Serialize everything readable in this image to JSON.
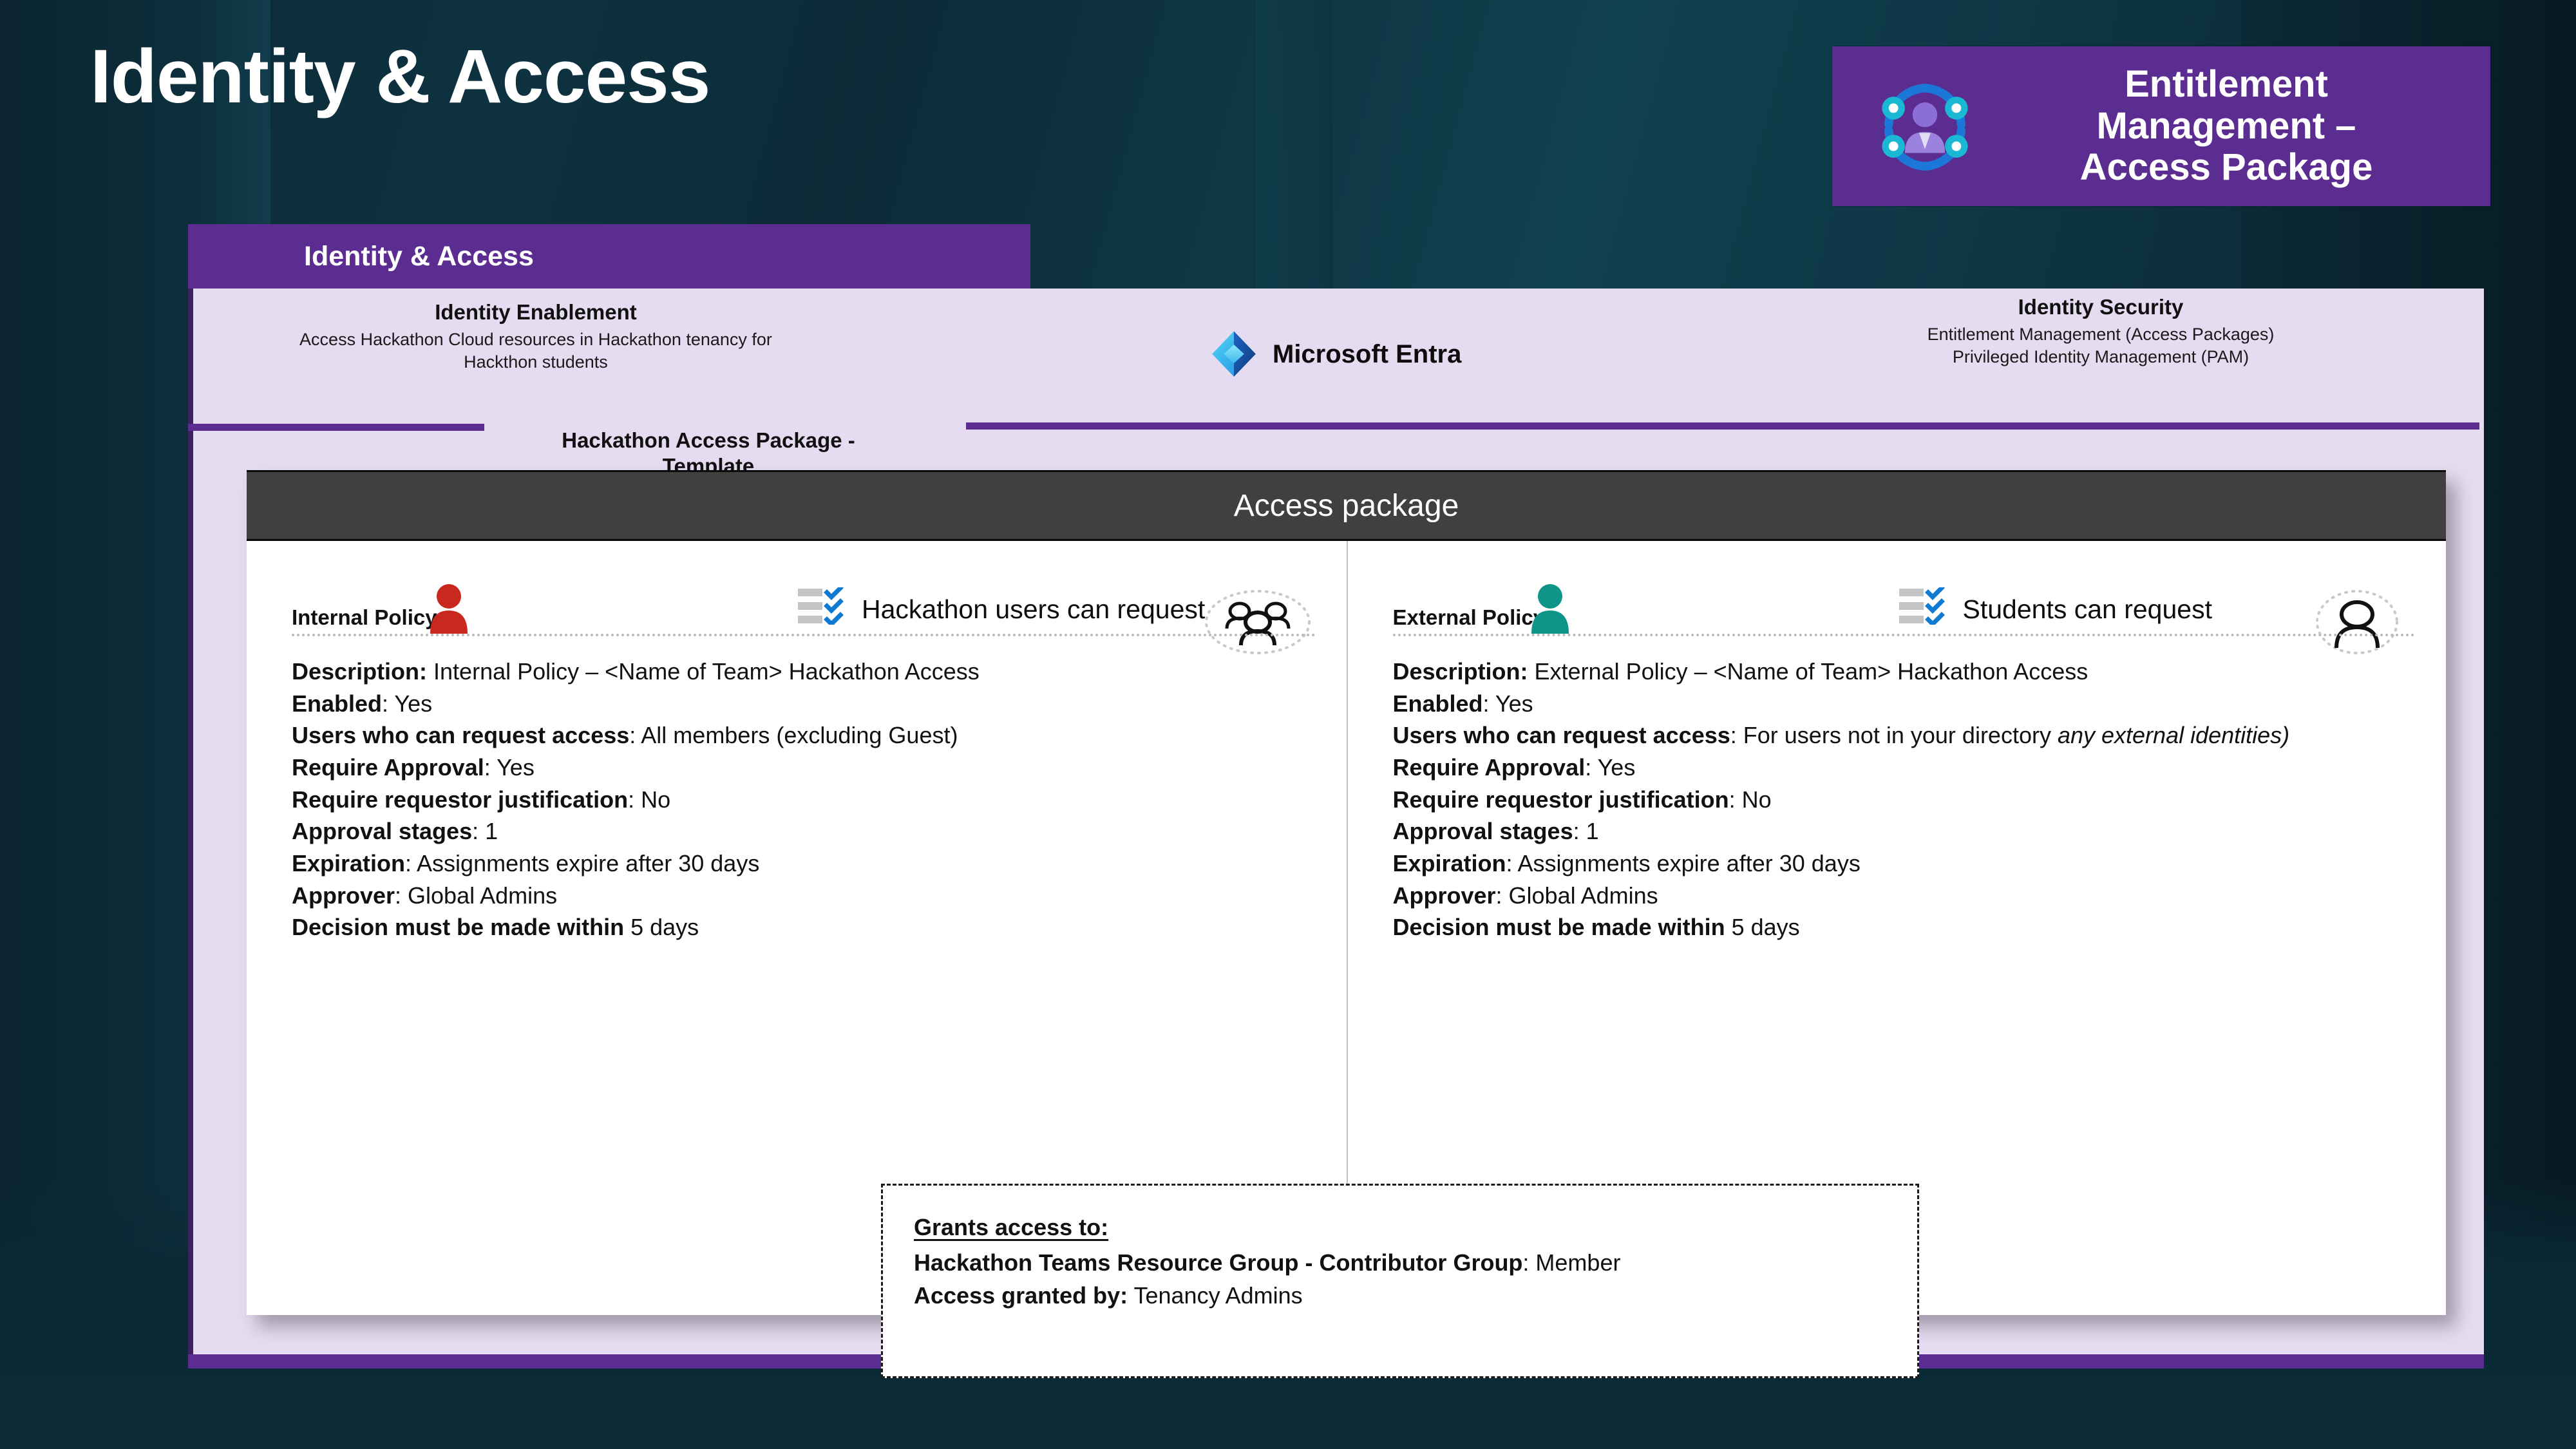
{
  "slide": {
    "title": "Identity & Access",
    "tab_label": "Identity & Access"
  },
  "badge": {
    "icon": "entitlement-management-icon",
    "line1": "Entitlement",
    "line2": "Management –",
    "line3": "Access Package",
    "background": "#5b2d91"
  },
  "header": {
    "left": {
      "title": "Identity Enablement",
      "subtitle_line1": "Access Hackathon Cloud resources in Hackathon tenancy for",
      "subtitle_line2": "Hackthon students"
    },
    "center": {
      "logo": "microsoft-entra-logo",
      "name": "Microsoft Entra"
    },
    "right": {
      "title": "Identity Security",
      "subtitle_line1": "Entitlement Management (Access Packages)",
      "subtitle_line2": "Privileged Identity Management (PAM)"
    }
  },
  "package_caption": {
    "line1": "Hackathon Access Package -",
    "line2": "Template"
  },
  "card": {
    "header_title": "Access package",
    "policies": [
      {
        "name": "Internal Policy",
        "person_icon": "person-icon-red",
        "person_color": "#c9281e",
        "checklist_icon": "checklist-icon",
        "tagline": "Hackathon users can request",
        "avatar_icon": "group-of-people-icon",
        "rows": [
          {
            "label": "Description:",
            "value": " Internal Policy – <Name of Team> Hackathon  Access"
          },
          {
            "label": "Enabled",
            "value": ": Yes"
          },
          {
            "label": "Users who can request access",
            "value": ": All members (excluding Guest)"
          },
          {
            "label": "Require Approval",
            "value": ": Yes"
          },
          {
            "label": "Require requestor justification",
            "value": ": No"
          },
          {
            "label": "Approval stages",
            "value": ": 1"
          },
          {
            "label": "Expiration",
            "value": ": Assignments expire after 30 days"
          },
          {
            "label": "Approver",
            "value": ": Global Admins"
          },
          {
            "label": "Decision must be made within",
            "value": " 5 days"
          }
        ]
      },
      {
        "name": "External Policy",
        "person_icon": "person-icon-teal",
        "person_color": "#0f9488",
        "checklist_icon": "checklist-icon",
        "tagline": "Students can request",
        "avatar_icon": "single-person-outline-icon",
        "rows": [
          {
            "label": "Description:",
            "value": " External Policy – <Name of Team> Hackathon Access"
          },
          {
            "label": "Enabled",
            "value": ": Yes"
          },
          {
            "label": "Users who can request access",
            "value": ": For users not in your directory ",
            "italic": "any external identities)"
          },
          {
            "label": "Require Approval",
            "value": ": Yes"
          },
          {
            "label": "Require requestor justification",
            "value": ": No"
          },
          {
            "label": "Approval stages",
            "value": ": 1"
          },
          {
            "label": "Expiration",
            "value": ": Assignments expire after 30 days"
          },
          {
            "label": "Approver",
            "value": ": Global Admins"
          },
          {
            "label": "Decision must be made within",
            "value": " 5 days"
          }
        ]
      }
    ]
  },
  "grants": {
    "title": "Grants access to:",
    "rows": [
      {
        "label": "Hackathon Teams Resource Group - Contributor Group",
        "value": ": Member"
      },
      {
        "label": "Access granted by:",
        "value": " Tenancy Admins"
      }
    ]
  },
  "colors": {
    "brand_purple": "#5b2d91",
    "panel_lavender": "#e6dcf2",
    "card_header_gray": "#404040",
    "backdrop_teal": "#0d3342"
  }
}
